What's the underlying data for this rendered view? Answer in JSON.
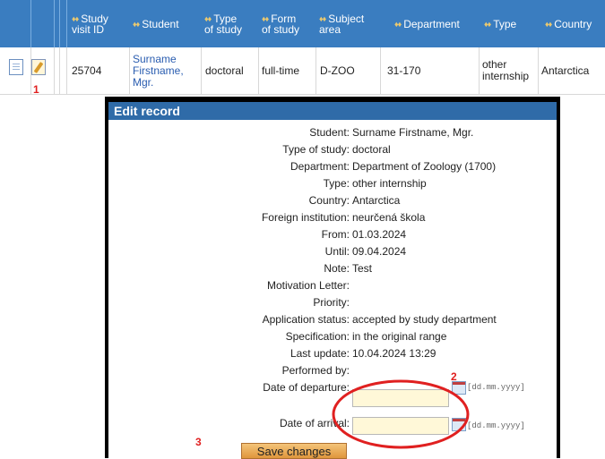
{
  "table": {
    "columns": [
      {
        "line1": "Study",
        "line2": "visit ID"
      },
      {
        "line1": "Student",
        "line2": ""
      },
      {
        "line1": "Type",
        "line2": "of study"
      },
      {
        "line1": "Form",
        "line2": "of study"
      },
      {
        "line1": "Subject",
        "line2": "area"
      },
      {
        "line1": "Department",
        "line2": ""
      },
      {
        "line1": "Type",
        "line2": ""
      },
      {
        "line1": "Country",
        "line2": ""
      }
    ],
    "sort_arrows": "♦♦",
    "row": {
      "id": "25704",
      "student_l1": "Surname",
      "student_l2": "Firstname,",
      "student_l3": "Mgr.",
      "type_of_study": "doctoral",
      "form_of_study": "full-time",
      "subject_area": "D-ZOO",
      "department": "31-170",
      "type_l1": "other",
      "type_l2": "internship",
      "country": "Antarctica"
    }
  },
  "annotations": {
    "n1": "1",
    "n2": "2",
    "n3": "3"
  },
  "dialog": {
    "title": "Edit record",
    "fields": [
      {
        "label": "Student:",
        "value": "Surname Firstname, Mgr."
      },
      {
        "label": "Type of study:",
        "value": "doctoral"
      },
      {
        "label": "Department:",
        "value": "Department of Zoology (1700)"
      },
      {
        "label": "Type:",
        "value": "other internship"
      },
      {
        "label": "Country:",
        "value": "Antarctica"
      },
      {
        "label": "Foreign institution:",
        "value": "neurčená škola"
      },
      {
        "label": "From:",
        "value": "01.03.2024"
      },
      {
        "label": "Until:",
        "value": "09.04.2024"
      },
      {
        "label": "Note:",
        "value": "Test"
      },
      {
        "label": "Motivation Letter:",
        "value": ""
      },
      {
        "label": "Priority:",
        "value": ""
      },
      {
        "label": "Application status:",
        "value": "accepted by study department"
      },
      {
        "label": "Specification:",
        "value": "in the original range"
      },
      {
        "label": "Last update:",
        "value": "10.04.2024 13:29"
      },
      {
        "label": "Performed by:",
        "value": ""
      }
    ],
    "departure_label": "Date of departure:",
    "departure_value": "",
    "arrival_label": "Date of arrival:",
    "arrival_value": "",
    "date_hint": "[dd.mm.yyyy]",
    "save_label": "Save changes"
  },
  "colors": {
    "header": "#3a7dc0",
    "dialog_title": "#2f6ba8",
    "annotation": "#e02020",
    "input_bg": "#fff8d8"
  }
}
